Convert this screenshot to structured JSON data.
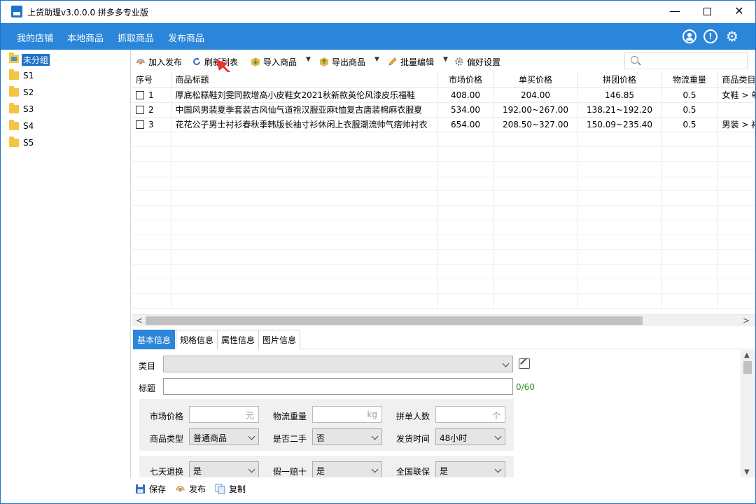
{
  "window": {
    "title": "上货助理v3.0.0.0 拼多多专业版",
    "minimize_glyph": "—",
    "close_glyph": "✕"
  },
  "menu": [
    "我的店铺",
    "本地商品",
    "抓取商品",
    "发布商品"
  ],
  "menu_icons": {
    "user": "user-icon",
    "info": "info-icon",
    "settings": "gear-icon",
    "info_glyph": "!",
    "settings_glyph": "⚙"
  },
  "sidebar": {
    "groups": [
      {
        "label": "未分组",
        "selected": true
      },
      {
        "label": "S1"
      },
      {
        "label": "S2"
      },
      {
        "label": "S3"
      },
      {
        "label": "S4"
      },
      {
        "label": "S5"
      }
    ]
  },
  "toolbar": {
    "add_publish": "加入发布",
    "refresh": "刷新列表",
    "import": "导入商品",
    "export": "导出商品",
    "batch_edit": "批量编辑",
    "preferences": "偏好设置",
    "search_placeholder": ""
  },
  "table": {
    "columns": [
      "序号",
      "商品标题",
      "市场价格",
      "单买价格",
      "拼团价格",
      "物流重量",
      "商品类目"
    ],
    "rows": [
      {
        "no": "1",
        "title": "厚底松糕鞋刘雯同款增高小皮鞋女2021秋新款英伦风漆皮乐福鞋",
        "market": "408.00",
        "single": "204.00",
        "group": "146.85",
        "weight": "0.5",
        "category": "女鞋 > 单"
      },
      {
        "no": "2",
        "title": "中国风男装夏季套装古风仙气道袍汉服亚麻t恤复古唐装棉麻衣服夏",
        "market": "534.00",
        "single": "192.00~267.00",
        "group": "138.21~192.20",
        "weight": "0.5",
        "category": ""
      },
      {
        "no": "3",
        "title": "花花公子男士衬衫春秋季韩版长袖寸衫休闲上衣服潮流帅气痞帅衬衣",
        "market": "654.00",
        "single": "208.50~327.00",
        "group": "150.09~235.40",
        "weight": "0.5",
        "category": "男装 > 衬"
      }
    ]
  },
  "tabs": [
    "基本信息",
    "规格信息",
    "属性信息",
    "图片信息"
  ],
  "form": {
    "category_label": "类目",
    "category_value": "",
    "title_label": "标题",
    "title_value": "",
    "title_counter": "0/60",
    "market_price_label": "市场价格",
    "market_price_unit": "元",
    "weight_label": "物流重量",
    "weight_unit": "kg",
    "group_size_label": "拼单人数",
    "group_size_unit": "个",
    "product_type_label": "商品类型",
    "product_type_value": "普通商品",
    "second_hand_label": "是否二手",
    "second_hand_value": "否",
    "ship_time_label": "发货时间",
    "ship_time_value": "48小时",
    "return7_label": "七天退换",
    "return7_value": "是",
    "fake_label": "假一赔十",
    "fake_value": "是",
    "warranty_label": "全国联保",
    "warranty_value": "是"
  },
  "bottom": {
    "save": "保存",
    "publish": "发布",
    "copy": "复制"
  },
  "colors": {
    "menubar": "#2b86d9",
    "accent": "#1e73c8",
    "arrow": "#e8322b"
  }
}
